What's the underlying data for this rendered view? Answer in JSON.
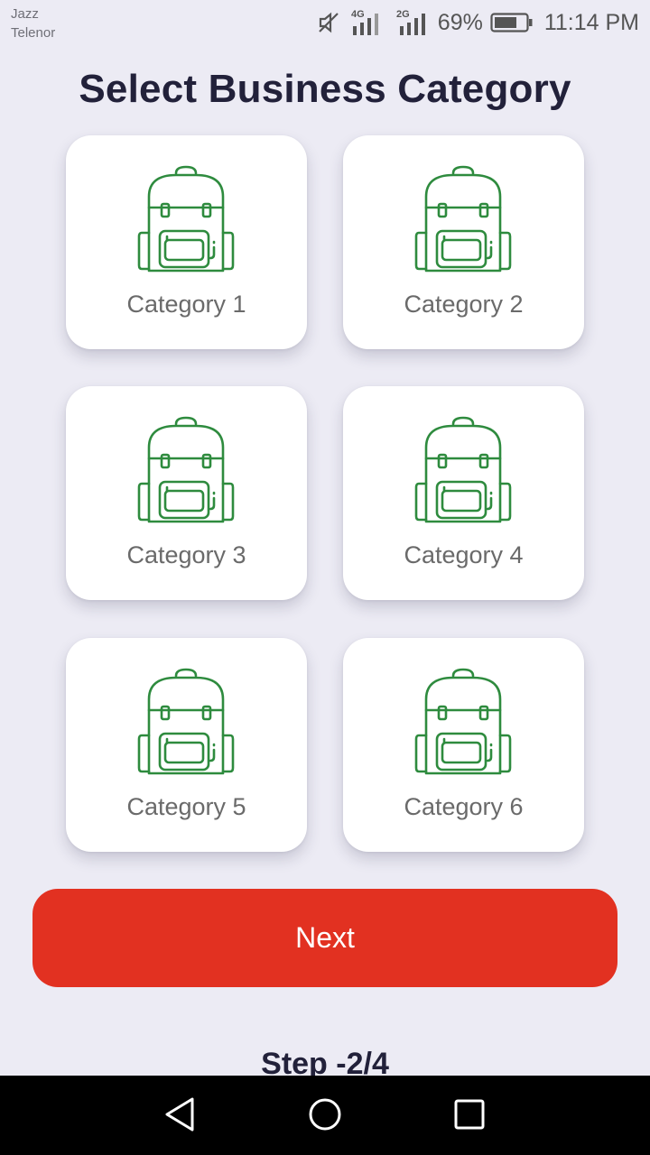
{
  "status_bar": {
    "carrier_1": "Jazz",
    "carrier_2": "Telenor",
    "network_1": "4G",
    "network_2": "2G",
    "battery_percent": "69%",
    "time": "11:14 PM"
  },
  "title": "Select Business Category",
  "categories": [
    {
      "label": "Category 1",
      "icon": "backpack-icon"
    },
    {
      "label": "Category 2",
      "icon": "backpack-icon"
    },
    {
      "label": "Category 3",
      "icon": "backpack-icon"
    },
    {
      "label": "Category 4",
      "icon": "backpack-icon"
    },
    {
      "label": "Category 5",
      "icon": "backpack-icon"
    },
    {
      "label": "Category 6",
      "icon": "backpack-icon"
    }
  ],
  "next_button": {
    "label": "Next"
  },
  "step": "Step -2/4",
  "colors": {
    "background": "#ecebf4",
    "primary_button": "#e23121",
    "icon_green": "#2e8b3e",
    "title_text": "#22213a"
  },
  "nav_bar": {
    "back": "back-icon",
    "home": "home-icon",
    "recent": "recent-apps-icon"
  }
}
